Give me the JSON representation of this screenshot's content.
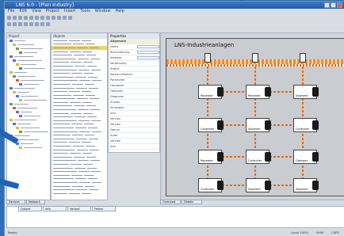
{
  "window": {
    "title": "LNS 6.0 - [Plan Industry]"
  },
  "menu": [
    "File",
    "Edit",
    "View",
    "Project",
    "Insert",
    "Tools",
    "Window",
    "Help"
  ],
  "tree": {
    "header": "Project"
  },
  "list": {
    "header": "Objects"
  },
  "props": {
    "header": "Properties",
    "rows": [
      "Allgemein",
      "Name",
      "Beschreibung",
      "Adresse",
      "Verbindung",
      "Status",
      "Kommunikation",
      "Parameter",
      "Hardware",
      "Optionen",
      "Diagnose",
      "Zusatz",
      "Sonstiges",
      "Info",
      "Version",
      "Version",
      "Datum",
      "Autor",
      "Version",
      "Info"
    ]
  },
  "canvas": {
    "title": "LNS-Industrieanlagen",
    "nodes": [
      "Repeater",
      "Repeater",
      "Segment",
      "Controller",
      "Segment",
      "Controller",
      "Repeater",
      "Controller",
      "Gateway",
      "Controller",
      "Segment",
      "Segment"
    ]
  },
  "bottom_tabs": [
    "Overview",
    "Details"
  ],
  "left_tabs": [
    "Devices",
    "Network"
  ],
  "output_tabs": [
    "Output",
    "Info",
    "Verlauf",
    "Fehler"
  ],
  "status": {
    "left": "Ready",
    "right": [
      "Local 100%",
      "NUM",
      "CAPS"
    ]
  },
  "colors": {
    "bus": "#f08a2a",
    "title_bar": "#2458a8",
    "selection": "#f2d46a"
  },
  "icons": [
    "app-icon",
    "minimize-icon",
    "maximize-icon",
    "close-icon"
  ]
}
